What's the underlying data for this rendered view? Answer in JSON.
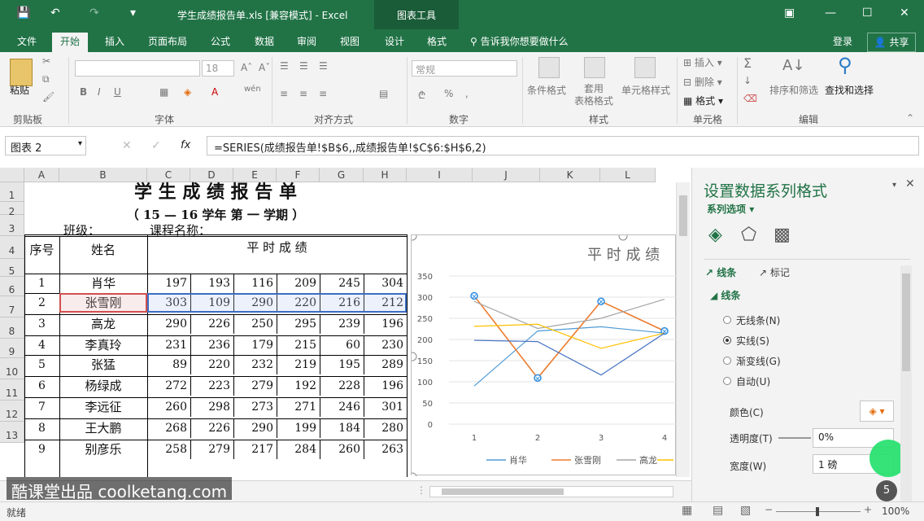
{
  "app": {
    "title": "学生成绩报告单.xls  [兼容模式] - Excel",
    "chart_tools": "图表工具"
  },
  "tabs": [
    "文件",
    "开始",
    "插入",
    "页面布局",
    "公式",
    "数据",
    "审阅",
    "视图",
    "设计",
    "格式"
  ],
  "tellme": "告诉我你想要做什么",
  "login": "登录",
  "share": "共享",
  "ribbon": {
    "paste": "粘贴",
    "clipboard": "剪贴板",
    "font_group": "字体",
    "font_size": "18",
    "align_group": "对齐方式",
    "number_format": "常规",
    "number_group": "数字",
    "cond_format": "条件格式",
    "table_format": "套用\n表格格式",
    "cell_style": "单元格样式",
    "style_group": "样式",
    "insert": "插入",
    "delete": "删除",
    "format": "格式",
    "cells_group": "单元格",
    "sort_filter": "排序和筛选",
    "find_select": "查找和选择",
    "edit_group": "编辑"
  },
  "formula_bar": {
    "name_box": "图表 2",
    "fx": "fx",
    "formula": "=SERIES(成绩报告单!$B$6,,成绩报告单!$C$6:$H$6,2)"
  },
  "columns": [
    "A",
    "B",
    "C",
    "D",
    "E",
    "F",
    "G",
    "H",
    "I",
    "J",
    "K",
    "L"
  ],
  "rows": [
    "1",
    "2",
    "3",
    "4",
    "5",
    "6",
    "7",
    "8",
    "9",
    "10",
    "11",
    "12",
    "13"
  ],
  "sheet": {
    "title": "学 生 成 绩 报 告 单",
    "subtitle": "（ 15 — 16   学年 第 一 学期 ）",
    "class_label": "班级：",
    "course_label": "课程名称：",
    "seq_header": "序号",
    "name_header": "姓名",
    "score_header": "平 时 成 绩",
    "students": [
      {
        "seq": "1",
        "name": "肖华",
        "scores": [
          "197",
          "193",
          "116",
          "209",
          "245",
          "304"
        ]
      },
      {
        "seq": "2",
        "name": "张雪刚",
        "scores": [
          "303",
          "109",
          "290",
          "220",
          "216",
          "212"
        ]
      },
      {
        "seq": "3",
        "name": "高龙",
        "scores": [
          "290",
          "226",
          "250",
          "295",
          "239",
          "196"
        ]
      },
      {
        "seq": "4",
        "name": "李真玲",
        "scores": [
          "231",
          "236",
          "179",
          "215",
          "60",
          "230"
        ]
      },
      {
        "seq": "5",
        "name": "张猛",
        "scores": [
          "89",
          "220",
          "232",
          "219",
          "195",
          "289"
        ]
      },
      {
        "seq": "6",
        "name": "杨绿成",
        "scores": [
          "272",
          "223",
          "279",
          "192",
          "228",
          "196"
        ]
      },
      {
        "seq": "7",
        "name": "李远征",
        "scores": [
          "260",
          "298",
          "273",
          "271",
          "246",
          "301"
        ]
      },
      {
        "seq": "8",
        "name": "王大鹏",
        "scores": [
          "268",
          "226",
          "290",
          "199",
          "184",
          "280"
        ]
      },
      {
        "seq": "9",
        "name": "别彦乐",
        "scores": [
          "258",
          "279",
          "217",
          "284",
          "260",
          "263"
        ]
      }
    ]
  },
  "chart_data": {
    "type": "line",
    "title": "平 时 成 绩",
    "x": [
      "1",
      "2",
      "3",
      "4"
    ],
    "ylim": [
      0,
      350
    ],
    "yticks": [
      "0",
      "50",
      "100",
      "150",
      "200",
      "250",
      "300",
      "350"
    ],
    "series": [
      {
        "name": "肖华",
        "color": "#4e9bd5",
        "values": [
          90,
          220,
          230,
          215
        ]
      },
      {
        "name": "张雪刚",
        "color": "#ed7d31",
        "values": [
          303,
          109,
          290,
          220
        ]
      },
      {
        "name": "高龙",
        "color": "#a5a5a5",
        "values": [
          290,
          226,
          250,
          295
        ]
      },
      {
        "name": "",
        "color": "#ffc000",
        "values": [
          231,
          236,
          179,
          215
        ]
      },
      {
        "name": "",
        "color": "#4472c4",
        "values": [
          198,
          195,
          116,
          215
        ]
      }
    ],
    "legend": [
      "肖华",
      "张雪刚",
      "高龙"
    ]
  },
  "pane": {
    "title": "设置数据系列格式",
    "options": "系列选项",
    "tab_line": "线条",
    "tab_marker": "标记",
    "section": "线条",
    "radios": [
      "无线条(N)",
      "实线(S)",
      "渐变线(G)",
      "自动(U)"
    ],
    "color_label": "颜色(C)",
    "transparency_label": "透明度(T)",
    "transparency": "0%",
    "width_label": "宽度(W)",
    "width": "1 磅"
  },
  "status": {
    "ready": "就绪",
    "zoom": "100%"
  },
  "watermark": "酷课堂出品 coolketang.com",
  "badge": "5"
}
